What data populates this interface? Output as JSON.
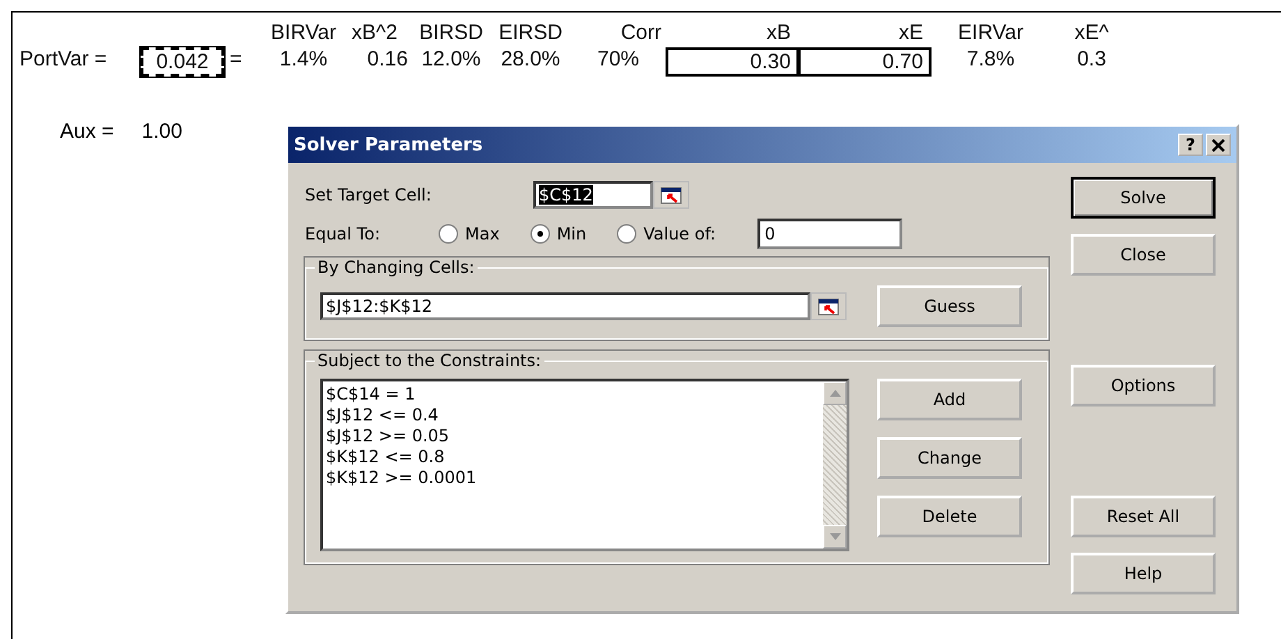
{
  "sheet": {
    "headers": [
      "BIRVar",
      "xB^2",
      "BIRSD",
      "EIRSD",
      "Corr",
      "xB",
      "xE",
      "EIRVar",
      "xE^"
    ],
    "row": {
      "label": "PortVar =",
      "target": "0.042",
      "equals": "=",
      "cells": [
        {
          "value": "1.4%",
          "kind": "value"
        },
        {
          "value": "0.16",
          "kind": "value"
        },
        {
          "value": "12.0%",
          "kind": "value"
        },
        {
          "value": "28.0%",
          "kind": "value"
        },
        {
          "value": "70%",
          "kind": "value"
        },
        {
          "value": "0.30",
          "kind": "input"
        },
        {
          "value": "0.70",
          "kind": "input"
        },
        {
          "value": "7.8%",
          "kind": "value"
        },
        {
          "value": "0.3",
          "kind": "value"
        }
      ]
    },
    "aux": {
      "label": "Aux =",
      "value": "1.00"
    }
  },
  "dialog": {
    "title": "Solver Parameters",
    "help_button": "?",
    "target": {
      "label": "Set Target Cell:",
      "value": "$C$12"
    },
    "equal_to": {
      "label": "Equal To:",
      "options": [
        {
          "label": "Max",
          "selected": false
        },
        {
          "label": "Min",
          "selected": true
        },
        {
          "label": "Value of:",
          "selected": false
        }
      ],
      "value": "0"
    },
    "changing": {
      "label": "By Changing Cells:",
      "value": "$J$12:$K$12",
      "button": "Guess"
    },
    "constraints": {
      "label": "Subject to the Constraints:",
      "items": [
        "$C$14 = 1",
        "$J$12 <= 0.4",
        "$J$12 >= 0.05",
        "$K$12 <= 0.8",
        "$K$12 >= 0.0001"
      ],
      "buttons": [
        "Add",
        "Change",
        "Delete"
      ]
    },
    "command_buttons": [
      [
        {
          "label": "Solve",
          "default": true
        },
        {
          "label": "Close",
          "default": false
        }
      ],
      [
        {
          "label": "Options",
          "default": false
        }
      ],
      [
        {
          "label": "Reset All",
          "default": false
        },
        {
          "label": "Help",
          "default": false
        }
      ]
    ]
  }
}
